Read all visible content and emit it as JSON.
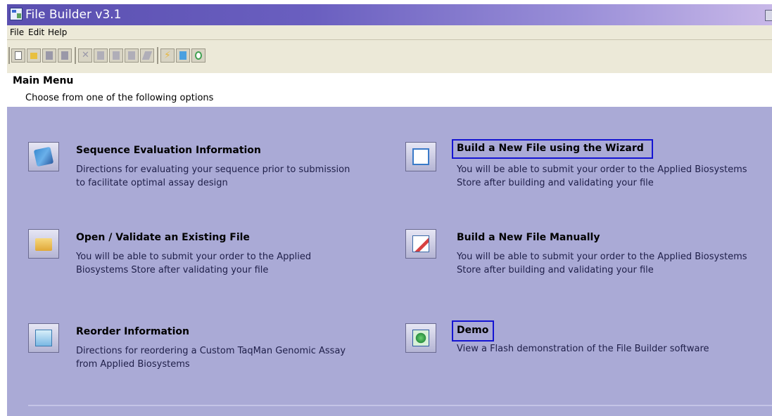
{
  "window": {
    "title": "File Builder v3.1"
  },
  "menu": [
    "File",
    "Edit",
    "Help"
  ],
  "toolbar": {
    "buttons": [
      {
        "name": "new-file-icon",
        "color": "#ffffff"
      },
      {
        "name": "open-folder-icon",
        "color": "#e8c040"
      },
      {
        "name": "save-icon",
        "color": "#9a98a8"
      },
      {
        "name": "save-as-icon",
        "color": "#9a98a8"
      },
      {
        "name": "cut-icon",
        "color": "#b0aeb8"
      },
      {
        "name": "copy-icon",
        "color": "#b0aeb8"
      },
      {
        "name": "paste-icon",
        "color": "#b0aeb8"
      },
      {
        "name": "find-icon",
        "color": "#b0aeb8"
      },
      {
        "name": "edit-icon",
        "color": "#b0aeb8"
      },
      {
        "name": "validate-icon",
        "color": "#e8b840"
      },
      {
        "name": "wizard-icon",
        "color": "#4aa0e0"
      },
      {
        "name": "demo-icon",
        "color": "#40a050"
      }
    ]
  },
  "main_menu": {
    "title": "Main Menu",
    "subtitle": "Choose from one of the following options"
  },
  "options": {
    "sequence_eval": {
      "title": "Sequence Evaluation Information",
      "desc1": "Directions for evaluating your sequence prior to submission",
      "desc2": "to facilitate optimal assay design",
      "icon": "sequence-evaluation-icon"
    },
    "open_validate": {
      "title": "Open / Validate an Existing File",
      "desc1": "You will be able to submit your order to the Applied",
      "desc2": "Biosystems Store after validating your file",
      "icon": "open-folder-icon"
    },
    "reorder": {
      "title": "Reorder Information",
      "desc1": "Directions for reordering a Custom TaqMan Genomic Assay",
      "desc2": "from Applied Biosystems",
      "icon": "reorder-icon"
    },
    "wizard": {
      "title": "Build a New File using the Wizard",
      "desc1": "You will be able to submit your order to the Applied Biosystems",
      "desc2": "Store after building and validating your file",
      "icon": "wizard-icon"
    },
    "manual": {
      "title": "Build a New File Manually",
      "desc1": "You will be able to submit your order to the Applied Biosystems",
      "desc2": "Store after building and validating your file",
      "icon": "manual-edit-icon"
    },
    "demo": {
      "title": "Demo",
      "desc1": "View a Flash demonstration of the File Builder software",
      "icon": "demo-icon"
    }
  },
  "colors": {
    "background": "#aaaad6",
    "title_bar": "#5a4fb0",
    "highlight_box": "#1414d2"
  }
}
